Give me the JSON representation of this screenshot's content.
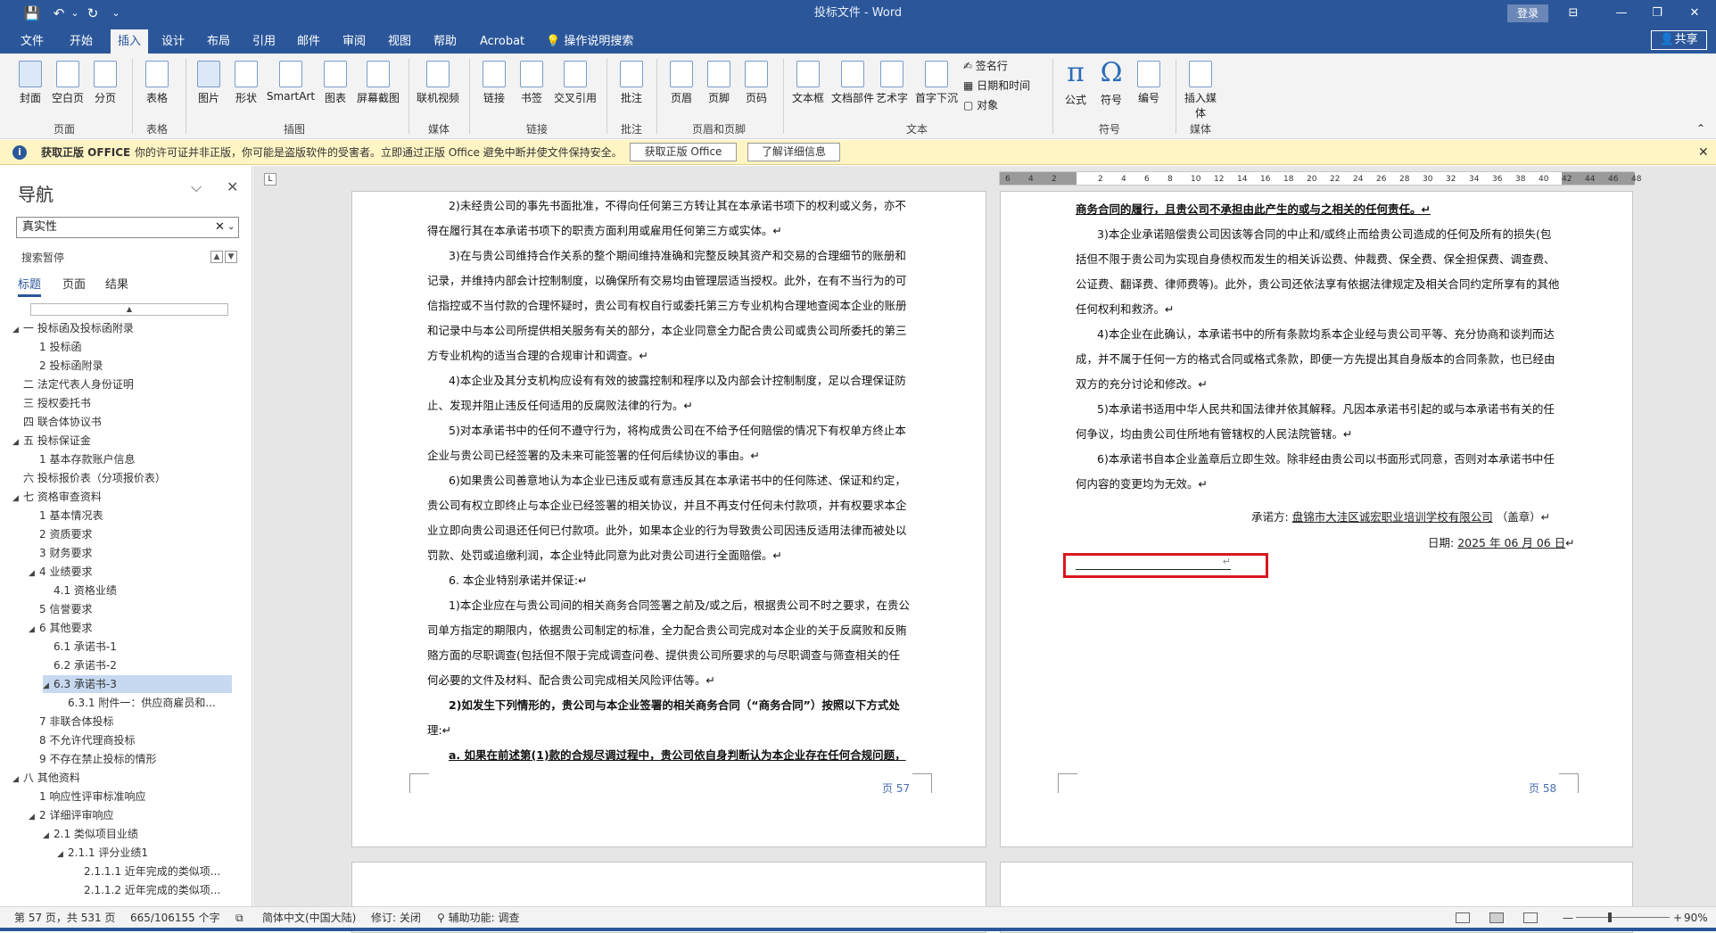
{
  "window": {
    "title": "投标文件  -  Word",
    "login": "登录",
    "share": "共享"
  },
  "quick_access": {
    "save": "💾",
    "undo": "↶",
    "dropdown": "⌄",
    "redo": "↻",
    "customize": "⌄"
  },
  "window_controls": {
    "ribbon_options": "⊟",
    "minimize": "—",
    "restore": "❐",
    "close": "✕"
  },
  "tabs": [
    "文件",
    "开始",
    "插入",
    "设计",
    "布局",
    "引用",
    "邮件",
    "审阅",
    "视图",
    "帮助",
    "Acrobat",
    "操作说明搜索"
  ],
  "ribbon": {
    "buttons": [
      {
        "id": "cover",
        "label": "封面"
      },
      {
        "id": "blank",
        "label": "空白页"
      },
      {
        "id": "break",
        "label": "分页"
      },
      {
        "id": "table",
        "label": "表格"
      },
      {
        "id": "picture",
        "label": "图片"
      },
      {
        "id": "shape",
        "label": "形状"
      },
      {
        "id": "smartart",
        "label": "SmartArt"
      },
      {
        "id": "chart",
        "label": "图表"
      },
      {
        "id": "screenshot",
        "label": "屏幕截图"
      },
      {
        "id": "video",
        "label": "联机视频"
      },
      {
        "id": "link",
        "label": "链接"
      },
      {
        "id": "bookmark",
        "label": "书签"
      },
      {
        "id": "crossref",
        "label": "交叉引用"
      },
      {
        "id": "comment",
        "label": "批注"
      },
      {
        "id": "header",
        "label": "页眉"
      },
      {
        "id": "footer",
        "label": "页脚"
      },
      {
        "id": "pagenum",
        "label": "页码"
      },
      {
        "id": "textbox",
        "label": "文本框"
      },
      {
        "id": "parts",
        "label": "文档部件"
      },
      {
        "id": "wordart",
        "label": "艺术字"
      },
      {
        "id": "dropcap",
        "label": "首字下沉"
      },
      {
        "id": "equation",
        "label": "公式",
        "glyph": "π"
      },
      {
        "id": "symbol",
        "label": "符号",
        "glyph": "Ω"
      },
      {
        "id": "number",
        "label": "编号"
      },
      {
        "id": "media",
        "label": "插入媒体"
      }
    ],
    "small": [
      "签名行",
      "日期和时间",
      "对象"
    ],
    "groups": [
      "页面",
      "表格",
      "插图",
      "媒体",
      "链接",
      "批注",
      "页眉和页脚",
      "文本",
      "符号",
      "媒体"
    ]
  },
  "infobar": {
    "title": "获取正版 OFFICE",
    "message": "你的许可证并非正版，你可能是盗版软件的受害者。立即通过正版 Office 避免中断并使文件保持安全。",
    "btn_get": "获取正版 Office",
    "btn_learn": "了解详细信息"
  },
  "nav": {
    "title": "导航",
    "search_value": "真实性",
    "paused": "搜索暂停",
    "tabs": [
      "标题",
      "页面",
      "结果"
    ],
    "items": [
      {
        "level": 0,
        "text": "一 投标函及投标函附录",
        "tw": "◢"
      },
      {
        "level": 1,
        "text": "1 投标函",
        "tw": ""
      },
      {
        "level": 1,
        "text": "2 投标函附录",
        "tw": ""
      },
      {
        "level": 0,
        "text": "二 法定代表人身份证明",
        "tw": ""
      },
      {
        "level": 0,
        "text": "三  授权委托书",
        "tw": ""
      },
      {
        "level": 0,
        "text": "四 联合体协议书",
        "tw": ""
      },
      {
        "level": 0,
        "text": "五 投标保证金",
        "tw": "◢"
      },
      {
        "level": 1,
        "text": "1 基本存款账户信息",
        "tw": ""
      },
      {
        "level": 0,
        "text": "六 投标报价表（分项报价表）",
        "tw": ""
      },
      {
        "level": 0,
        "text": "七 资格审查资料",
        "tw": "◢"
      },
      {
        "level": 1,
        "text": "1 基本情况表",
        "tw": ""
      },
      {
        "level": 1,
        "text": "2 资质要求",
        "tw": ""
      },
      {
        "level": 1,
        "text": "3 财务要求",
        "tw": ""
      },
      {
        "level": 1,
        "text": "4 业绩要求",
        "tw": "◢"
      },
      {
        "level": 2,
        "text": "4.1 资格业绩",
        "tw": ""
      },
      {
        "level": 1,
        "text": "5 信誉要求",
        "tw": ""
      },
      {
        "level": 1,
        "text": "6 其他要求",
        "tw": "◢"
      },
      {
        "level": 2,
        "text": "6.1 承诺书-1",
        "tw": ""
      },
      {
        "level": 2,
        "text": "6.2 承诺书-2",
        "tw": ""
      },
      {
        "level": 2,
        "text": "6.3 承诺书-3",
        "tw": "◢",
        "selected": true
      },
      {
        "level": 3,
        "text": "6.3.1 附件一：供应商雇员和...",
        "tw": ""
      },
      {
        "level": 1,
        "text": "7 非联合体投标",
        "tw": ""
      },
      {
        "level": 1,
        "text": "8 不允许代理商投标",
        "tw": ""
      },
      {
        "level": 1,
        "text": "9 不存在禁止投标的情形",
        "tw": ""
      },
      {
        "level": 0,
        "text": "八 其他资料",
        "tw": "◢"
      },
      {
        "level": 1,
        "text": "1 响应性评审标准响应",
        "tw": ""
      },
      {
        "level": 1,
        "text": "2 详细评审响应",
        "tw": "◢"
      },
      {
        "level": 2,
        "text": "2.1 类似项目业绩",
        "tw": "◢"
      },
      {
        "level": 3,
        "text": "2.1.1 评分业绩1",
        "tw": "◢"
      },
      {
        "level": 4,
        "text": "2.1.1.1 近年完成的类似项...",
        "tw": ""
      },
      {
        "level": 4,
        "text": "2.1.1.2 近年完成的类似项...",
        "tw": ""
      }
    ]
  },
  "ruler": {
    "labels": [
      "6",
      "4",
      "2",
      "",
      "2",
      "4",
      "6",
      "8",
      "10",
      "12",
      "14",
      "16",
      "18",
      "20",
      "22",
      "24",
      "26",
      "28",
      "30",
      "32",
      "34",
      "36",
      "38",
      "40",
      "42",
      "44",
      "46",
      "48"
    ]
  },
  "page57": {
    "lines": [
      {
        "t": "2)未经贵公司的事先书面批准，不得向任何第三方转让其在本承诺书项下的权利或义务，亦不",
        "c": ""
      },
      {
        "t": "得在履行其在本承诺书项下的职责方面利用或雇用任何第三方或实体。↵",
        "c": ""
      },
      {
        "t": "3)在与贵公司维持合作关系的整个期间维持准确和完整反映其资产和交易的合理细节的账册和",
        "c": ""
      },
      {
        "t": "记录，并维持内部会计控制制度，以确保所有交易均由管理层适当授权。此外，在有不当行为的可",
        "c": ""
      },
      {
        "t": "信指控或不当付款的合理怀疑时，贵公司有权自行或委托第三方专业机构合理地查阅本企业的账册",
        "c": ""
      },
      {
        "t": "和记录中与本公司所提供相关服务有关的部分，本企业同意全力配合贵公司或贵公司所委托的第三",
        "c": ""
      },
      {
        "t": "方专业机构的适当合理的合规审计和调查。↵",
        "c": ""
      },
      {
        "t": "4)本企业及其分支机构应设有有效的披露控制和程序以及内部会计控制制度，足以合理保证防",
        "c": ""
      },
      {
        "t": "止、发现并阻止违反任何适用的反腐败法律的行为。↵",
        "c": ""
      },
      {
        "t": "5)对本承诺书中的任何不遵守行为，将构成贵公司在不给予任何赔偿的情况下有权单方终止本",
        "c": ""
      },
      {
        "t": "企业与贵公司已经签署的及未来可能签署的任何后续协议的事由。↵",
        "c": ""
      },
      {
        "t": "6)如果贵公司善意地认为本企业已违反或有意违反其在本承诺书中的任何陈述、保证和约定，",
        "c": ""
      },
      {
        "t": "贵公司有权立即终止与本企业已经签署的相关协议，并且不再支付任何未付款项，并有权要求本企",
        "c": ""
      },
      {
        "t": "业立即向贵公司退还任何已付款项。此外，如果本企业的行为导致贵公司因违反适用法律而被处以",
        "c": ""
      },
      {
        "t": "罚款、处罚或追缴利润，本企业特此同意为此对贵公司进行全面赔偿。↵",
        "c": ""
      },
      {
        "t": "6. 本企业特别承诺并保证:↵",
        "c": ""
      },
      {
        "t": "1)本企业应在与贵公司间的相关商务合同签署之前及/或之后，根据贵公司不时之要求，在贵公",
        "c": ""
      },
      {
        "t": "司单方指定的期限内，依据贵公司制定的标准，全力配合贵公司完成对本企业的关于反腐败和反贿",
        "c": ""
      },
      {
        "t": "赂方面的尽职调查(包括但不限于完成调查问卷、提供贵公司所要求的与尽职调查与筛查相关的任",
        "c": ""
      },
      {
        "t": "何必要的文件及材料、配合贵公司完成相关风险评估等。↵",
        "c": ""
      },
      {
        "t": "2)如发生下列情形的，贵公司与本企业签署的相关商务合同（“商务合同”）按照以下方式处",
        "c": "b"
      },
      {
        "t": "理:↵",
        "c": ""
      },
      {
        "t": "a. 如果在前述第(1)款的合规尽调过程中，贵公司依自身判断认为本企业存在任何合规问题，",
        "c": "b ul"
      }
    ],
    "page_number": "页 57"
  },
  "page58": {
    "lines": [
      {
        "t": "商务合同的履行，且贵公司不承担由此产生的或与之相关的任何责任。↵",
        "c": "b ul"
      },
      {
        "t": "3)本企业承诺赔偿贵公司因该等合同的中止和/或终止而给贵公司造成的任何及所有的损失(包",
        "c": ""
      },
      {
        "t": "括但不限于贵公司为实现自身债权而发生的相关诉讼费、仲裁费、保全费、保全担保费、调查费、",
        "c": ""
      },
      {
        "t": "公证费、翻译费、律师费等)。此外，贵公司还依法享有依据法律规定及相关合同约定所享有的其他",
        "c": ""
      },
      {
        "t": "任何权利和救济。↵",
        "c": ""
      },
      {
        "t": "4)本企业在此确认，本承诺书中的所有条款均系本企业经与贵公司平等、充分协商和谈判而达",
        "c": ""
      },
      {
        "t": "成，并不属于任何一方的格式合同或格式条款，即便一方先提出其自身版本的合同条款，也已经由",
        "c": ""
      },
      {
        "t": "双方的充分讨论和修改。↵",
        "c": ""
      },
      {
        "t": "5)本承诺书适用中华人民共和国法律并依其解释。凡因本承诺书引起的或与本承诺书有关的任",
        "c": ""
      },
      {
        "t": "何争议，均由贵公司住所地有管辖权的人民法院管辖。↵",
        "c": ""
      },
      {
        "t": "6)本承诺书自本企业盖章后立即生效。除非经由贵公司以书面形式同意，否则对本承诺书中任",
        "c": ""
      },
      {
        "t": "何内容的变更均为无效。↵",
        "c": ""
      }
    ],
    "sign_label": "承诺方:",
    "sign_company": "盘锦市大洼区诚宏职业培训学校有限公司",
    "sign_seal": "（盖章）↵",
    "date_label": "日期:",
    "date_value": "2025 年 06 月 06 日",
    "date_end": "↵",
    "blank_line": "↵",
    "page_number": "页 58"
  },
  "status": {
    "page": "第 57 页，共 531 页",
    "words": "665/106155 个字",
    "lang": "简体中文(中国大陆)",
    "track": "修订: 关闭",
    "access": "辅助功能: 调查",
    "zoom": "90%",
    "zoom_minus": "—",
    "zoom_plus": "+"
  },
  "colors": {
    "brand": "#2b579a",
    "highlight": "#d8181e"
  }
}
